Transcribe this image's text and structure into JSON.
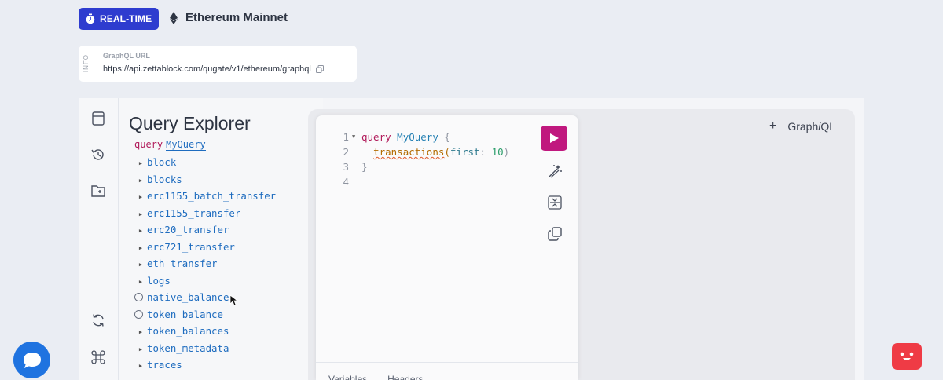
{
  "header": {
    "badge_label": "REAL-TIME",
    "network": "Ethereum Mainnet"
  },
  "info": {
    "tab": "INFO",
    "label": "GraphQL URL",
    "url": "https://api.zettablock.com/qugate/v1/ethereum/graphql"
  },
  "explorer": {
    "title": "Query Explorer",
    "query_keyword": "query",
    "query_name": "MyQuery",
    "fields": [
      {
        "name": "block",
        "kind": "caret"
      },
      {
        "name": "blocks",
        "kind": "caret"
      },
      {
        "name": "erc1155_batch_transfer",
        "kind": "caret"
      },
      {
        "name": "erc1155_transfer",
        "kind": "caret"
      },
      {
        "name": "erc20_transfer",
        "kind": "caret"
      },
      {
        "name": "erc721_transfer",
        "kind": "caret"
      },
      {
        "name": "eth_transfer",
        "kind": "caret"
      },
      {
        "name": "logs",
        "kind": "caret"
      },
      {
        "name": "native_balance",
        "kind": "radio"
      },
      {
        "name": "token_balance",
        "kind": "radio"
      },
      {
        "name": "token_balances",
        "kind": "caret"
      },
      {
        "name": "token_metadata",
        "kind": "caret"
      },
      {
        "name": "traces",
        "kind": "caret"
      }
    ]
  },
  "editor": {
    "lines": [
      "1",
      "2",
      "3",
      "4"
    ],
    "code": {
      "kw_query": "query",
      "op_name": "MyQuery",
      "open_brace": "{",
      "field": "transactions",
      "paren_open": "(",
      "arg": "first",
      "colon": ":",
      "arg_value": "10",
      "paren_close": ")",
      "close_brace": "}"
    },
    "tabs": [
      "Variables",
      "Headers"
    ]
  },
  "graphiql": {
    "plus": "+",
    "title_prefix": "Graph",
    "title_italic": "i",
    "title_suffix": "QL"
  },
  "colors": {
    "badge": "#2e3ccf",
    "run_button": "#c0187e",
    "chat": "#1f73e0",
    "bot": "#ef3b45"
  }
}
